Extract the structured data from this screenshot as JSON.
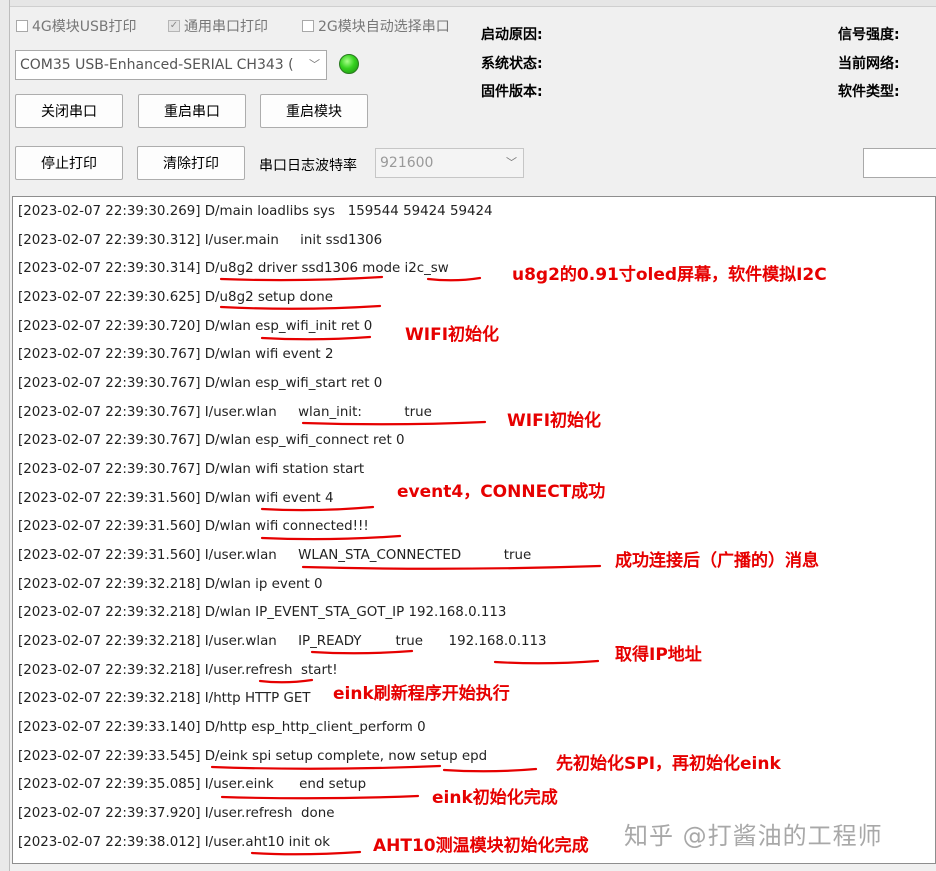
{
  "toolbar": {
    "checkboxes": [
      {
        "label": "4G模块USB打印",
        "checked": false
      },
      {
        "label": "通用串口打印",
        "checked": true
      },
      {
        "label": "2G模块自动选择串口",
        "checked": false
      }
    ],
    "port_select": "COM35 USB-Enhanced-SERIAL CH343 (",
    "buttons": {
      "close_port": "关闭串口",
      "restart_port": "重启串口",
      "restart_module": "重启模块",
      "stop_print": "停止打印",
      "clear_print": "清除打印"
    },
    "baud_label": "串口日志波特率",
    "baud_value": "921600"
  },
  "status": {
    "boot_reason": "启动原因:",
    "system_status": "系统状态:",
    "firmware_version": "固件版本:",
    "signal_strength": "信号强度:",
    "current_network": "当前网络:",
    "software_type": "软件类型:"
  },
  "log_lines": [
    "[2023-02-07 22:39:30.269] D/main loadlibs sys   159544 59424 59424",
    "[2023-02-07 22:39:30.312] I/user.main     init ssd1306",
    "[2023-02-07 22:39:30.314] D/u8g2 driver ssd1306 mode i2c_sw",
    "[2023-02-07 22:39:30.625] D/u8g2 setup done",
    "[2023-02-07 22:39:30.720] D/wlan esp_wifi_init ret 0",
    "[2023-02-07 22:39:30.767] D/wlan wifi event 2",
    "[2023-02-07 22:39:30.767] D/wlan esp_wifi_start ret 0",
    "[2023-02-07 22:39:30.767] I/user.wlan     wlan_init:          true",
    "[2023-02-07 22:39:30.767] D/wlan esp_wifi_connect ret 0",
    "[2023-02-07 22:39:30.767] D/wlan wifi station start",
    "[2023-02-07 22:39:31.560] D/wlan wifi event 4",
    "[2023-02-07 22:39:31.560] D/wlan wifi connected!!!",
    "[2023-02-07 22:39:31.560] I/user.wlan     WLAN_STA_CONNECTED          true",
    "[2023-02-07 22:39:32.218] D/wlan ip event 0",
    "[2023-02-07 22:39:32.218] D/wlan IP_EVENT_STA_GOT_IP 192.168.0.113",
    "[2023-02-07 22:39:32.218] I/user.wlan     IP_READY        true      192.168.0.113",
    "[2023-02-07 22:39:32.218] I/user.refresh  start!",
    "[2023-02-07 22:39:32.218] I/http HTTP GET",
    "[2023-02-07 22:39:33.140] D/http esp_http_client_perform 0",
    "[2023-02-07 22:39:33.545] D/eink spi setup complete, now setup epd",
    "[2023-02-07 22:39:35.085] I/user.eink      end setup",
    "[2023-02-07 22:39:37.920] I/user.refresh  done",
    "[2023-02-07 22:39:38.012] I/user.aht10 init ok"
  ],
  "annotations": [
    "u8g2的0.91寸oled屏幕，软件模拟I2C",
    "WIFI初始化",
    "WIFI初始化",
    "event4，CONNECT成功",
    "成功连接后（广播的）消息",
    "取得IP地址",
    "eink刷新程序开始执行",
    "先初始化SPI，再初始化eink",
    "eink初始化完成",
    "AHT10测温模块初始化完成"
  ],
  "watermark": "知乎 @打酱油的工程师",
  "colors": {
    "annotation": "#e60000",
    "led": "#35d21f"
  }
}
